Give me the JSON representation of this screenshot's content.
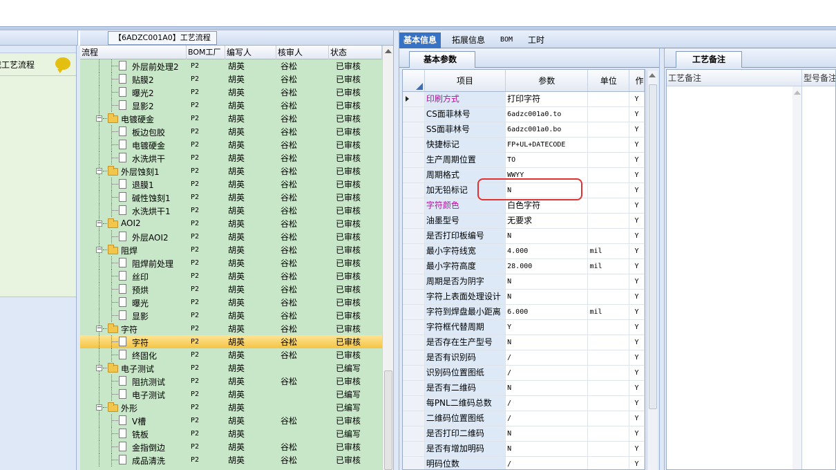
{
  "left": {
    "item_label": "载工艺流程"
  },
  "tree": {
    "title": "【6ADZC001A0】工艺流程",
    "headers": {
      "name": "流程",
      "bom": "BOM工厂",
      "writer": "编写人",
      "checker": "核审人",
      "status": "状态"
    },
    "rows": [
      {
        "label": "外层前处理2",
        "level": 2,
        "type": "doc",
        "bom": "P2",
        "writer": "胡英",
        "checker": "谷松",
        "status": "已审核"
      },
      {
        "label": "贴膜2",
        "level": 2,
        "type": "doc",
        "bom": "P2",
        "writer": "胡英",
        "checker": "谷松",
        "status": "已审核"
      },
      {
        "label": "曝光2",
        "level": 2,
        "type": "doc",
        "bom": "P2",
        "writer": "胡英",
        "checker": "谷松",
        "status": "已审核"
      },
      {
        "label": "显影2",
        "level": 2,
        "type": "doc",
        "bom": "P2",
        "writer": "胡英",
        "checker": "谷松",
        "status": "已审核"
      },
      {
        "label": "电镀硬金",
        "level": 1,
        "type": "folder",
        "bom": "P2",
        "writer": "胡英",
        "checker": "谷松",
        "status": "已审核"
      },
      {
        "label": "板边包胶",
        "level": 2,
        "type": "doc",
        "bom": "P2",
        "writer": "胡英",
        "checker": "谷松",
        "status": "已审核"
      },
      {
        "label": "电镀硬金",
        "level": 2,
        "type": "doc",
        "bom": "P2",
        "writer": "胡英",
        "checker": "谷松",
        "status": "已审核"
      },
      {
        "label": "水洗烘干",
        "level": 2,
        "type": "doc",
        "bom": "P2",
        "writer": "胡英",
        "checker": "谷松",
        "status": "已审核"
      },
      {
        "label": "外层蚀刻1",
        "level": 1,
        "type": "folder",
        "bom": "P2",
        "writer": "胡英",
        "checker": "谷松",
        "status": "已审核"
      },
      {
        "label": "退膜1",
        "level": 2,
        "type": "doc",
        "bom": "P2",
        "writer": "胡英",
        "checker": "谷松",
        "status": "已审核"
      },
      {
        "label": "碱性蚀刻1",
        "level": 2,
        "type": "doc",
        "bom": "P2",
        "writer": "胡英",
        "checker": "谷松",
        "status": "已审核"
      },
      {
        "label": "水洗烘干1",
        "level": 2,
        "type": "doc",
        "bom": "P2",
        "writer": "胡英",
        "checker": "谷松",
        "status": "已审核"
      },
      {
        "label": "AOI2",
        "level": 1,
        "type": "folder",
        "bom": "P2",
        "writer": "胡英",
        "checker": "谷松",
        "status": "已审核"
      },
      {
        "label": "外层AOI2",
        "level": 2,
        "type": "doc",
        "bom": "P2",
        "writer": "胡英",
        "checker": "谷松",
        "status": "已审核"
      },
      {
        "label": "阻焊",
        "level": 1,
        "type": "folder",
        "bom": "P2",
        "writer": "胡英",
        "checker": "谷松",
        "status": "已审核"
      },
      {
        "label": "阻焊前处理",
        "level": 2,
        "type": "doc",
        "bom": "P2",
        "writer": "胡英",
        "checker": "谷松",
        "status": "已审核"
      },
      {
        "label": "丝印",
        "level": 2,
        "type": "doc",
        "bom": "P2",
        "writer": "胡英",
        "checker": "谷松",
        "status": "已审核"
      },
      {
        "label": "预烘",
        "level": 2,
        "type": "doc",
        "bom": "P2",
        "writer": "胡英",
        "checker": "谷松",
        "status": "已审核"
      },
      {
        "label": "曝光",
        "level": 2,
        "type": "doc",
        "bom": "P2",
        "writer": "胡英",
        "checker": "谷松",
        "status": "已审核"
      },
      {
        "label": "显影",
        "level": 2,
        "type": "doc",
        "bom": "P2",
        "writer": "胡英",
        "checker": "谷松",
        "status": "已审核"
      },
      {
        "label": "字符",
        "level": 1,
        "type": "folder",
        "bom": "P2",
        "writer": "胡英",
        "checker": "谷松",
        "status": "已审核"
      },
      {
        "label": "字符",
        "level": 2,
        "type": "doc",
        "bom": "P2",
        "writer": "胡英",
        "checker": "谷松",
        "status": "已审核",
        "selected": true
      },
      {
        "label": "终固化",
        "level": 2,
        "type": "doc",
        "bom": "P2",
        "writer": "胡英",
        "checker": "谷松",
        "status": "已审核"
      },
      {
        "label": "电子测试",
        "level": 1,
        "type": "folder",
        "bom": "P2",
        "writer": "胡英",
        "checker": "",
        "status": "已编写"
      },
      {
        "label": "阻抗测试",
        "level": 2,
        "type": "doc",
        "bom": "P2",
        "writer": "胡英",
        "checker": "谷松",
        "status": "已审核"
      },
      {
        "label": "电子测试",
        "level": 2,
        "type": "doc",
        "bom": "P2",
        "writer": "胡英",
        "checker": "",
        "status": "已编写"
      },
      {
        "label": "外形",
        "level": 1,
        "type": "folder",
        "bom": "P2",
        "writer": "胡英",
        "checker": "",
        "status": "已编写"
      },
      {
        "label": "V槽",
        "level": 2,
        "type": "doc",
        "bom": "P2",
        "writer": "胡英",
        "checker": "谷松",
        "status": "已审核"
      },
      {
        "label": "铣板",
        "level": 2,
        "type": "doc",
        "bom": "P2",
        "writer": "胡英",
        "checker": "",
        "status": "已编写"
      },
      {
        "label": "金指倒边",
        "level": 2,
        "type": "doc",
        "bom": "P2",
        "writer": "胡英",
        "checker": "谷松",
        "status": "已审核"
      },
      {
        "label": "成品清洗",
        "level": 2,
        "type": "doc",
        "bom": "P2",
        "writer": "胡英",
        "checker": "谷松",
        "status": "已审核"
      }
    ]
  },
  "tabs": [
    "基本信息",
    "拓展信息",
    "BOM",
    "工时"
  ],
  "params": {
    "tab": "基本参数",
    "headers": {
      "item": "项目",
      "value": "参数",
      "unit": "单位",
      "extra": "作"
    },
    "rows": [
      {
        "item": "印刷方式",
        "value": "打印字符",
        "unit": "",
        "flag": "Y",
        "pink": true,
        "cn": true
      },
      {
        "item": "CS面菲林号",
        "value": "6adzc001a0.to",
        "unit": "",
        "flag": "Y"
      },
      {
        "item": "SS面菲林号",
        "value": "6adzc001a0.bo",
        "unit": "",
        "flag": "Y"
      },
      {
        "item": "快捷标记",
        "value": "FP+UL+DATECODE",
        "unit": "",
        "flag": "Y"
      },
      {
        "item": "生产周期位置",
        "value": "TO",
        "unit": "",
        "flag": "Y"
      },
      {
        "item": "周期格式",
        "value": "WWYY",
        "unit": "",
        "flag": "Y"
      },
      {
        "item": "加无铅标记",
        "value": "N",
        "unit": "",
        "flag": "Y"
      },
      {
        "item": "字符颜色",
        "value": "白色字符",
        "unit": "",
        "flag": "Y",
        "pink": true,
        "cn": true
      },
      {
        "item": "油墨型号",
        "value": "无要求",
        "unit": "",
        "flag": "Y",
        "cn": true
      },
      {
        "item": "是否打印板编号",
        "value": "N",
        "unit": "",
        "flag": "Y"
      },
      {
        "item": "最小字符线宽",
        "value": "4.000",
        "unit": "mil",
        "flag": "Y"
      },
      {
        "item": "最小字符高度",
        "value": "28.000",
        "unit": "mil",
        "flag": "Y"
      },
      {
        "item": "周期是否为阴字",
        "value": "N",
        "unit": "",
        "flag": "Y"
      },
      {
        "item": "字符上表面处理设计",
        "value": "N",
        "unit": "",
        "flag": "Y"
      },
      {
        "item": "字符到焊盘最小距离",
        "value": "6.000",
        "unit": "mil",
        "flag": "Y"
      },
      {
        "item": "字符框代替周期",
        "value": "Y",
        "unit": "",
        "flag": "Y"
      },
      {
        "item": "是否存在生产型号",
        "value": "N",
        "unit": "",
        "flag": "Y"
      },
      {
        "item": "是否有识别码",
        "value": "/",
        "unit": "",
        "flag": "Y"
      },
      {
        "item": "识别码位置图纸",
        "value": "/",
        "unit": "",
        "flag": "Y"
      },
      {
        "item": "是否有二维码",
        "value": "N",
        "unit": "",
        "flag": "Y"
      },
      {
        "item": "每PNL二维码总数",
        "value": "/",
        "unit": "",
        "flag": "Y"
      },
      {
        "item": "二维码位置图纸",
        "value": "/",
        "unit": "",
        "flag": "Y"
      },
      {
        "item": "是否打印二维码",
        "value": "N",
        "unit": "",
        "flag": "Y"
      },
      {
        "item": "是否有增加明码",
        "value": "N",
        "unit": "",
        "flag": "Y"
      },
      {
        "item": "明码位数",
        "value": "/",
        "unit": "",
        "flag": "Y"
      }
    ]
  },
  "remarks": {
    "tab": "工艺备注",
    "col1": "工艺备注",
    "col2": "型号备注"
  }
}
